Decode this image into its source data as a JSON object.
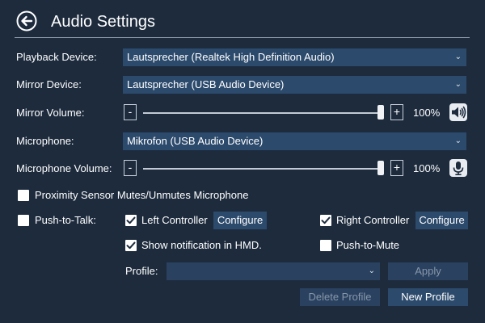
{
  "header": {
    "title": "Audio Settings"
  },
  "playback": {
    "label": "Playback Device:",
    "value": "Lautsprecher (Realtek High Definition Audio)"
  },
  "mirror_device": {
    "label": "Mirror Device:",
    "value": "Lautsprecher (USB Audio Device)"
  },
  "mirror_volume": {
    "label": "Mirror Volume:",
    "minus": "-",
    "plus": "+",
    "percent": "100%",
    "level": 1.0
  },
  "microphone": {
    "label": "Microphone:",
    "value": "Mikrofon (USB Audio Device)"
  },
  "microphone_volume": {
    "label": "Microphone Volume:",
    "minus": "-",
    "plus": "+",
    "percent": "100%",
    "level": 1.0
  },
  "proximity": {
    "label": "Proximity Sensor Mutes/Unmutes Microphone",
    "checked": false
  },
  "ptt": {
    "label": "Push-to-Talk:",
    "checked": false,
    "left_controller": {
      "label": "Left Controller",
      "checked": true,
      "configure": "Configure"
    },
    "right_controller": {
      "label": "Right Controller",
      "checked": true,
      "configure": "Configure"
    },
    "show_notification": {
      "label": "Show notification in HMD.",
      "checked": true
    },
    "push_to_mute": {
      "label": "Push-to-Mute",
      "checked": false
    }
  },
  "profile": {
    "label": "Profile:",
    "value": "",
    "apply": "Apply",
    "delete": "Delete Profile",
    "new": "New Profile"
  },
  "colors": {
    "background": "#1d2b3d",
    "select": "#2c4a6c",
    "disabled_text": "#8797a9"
  }
}
